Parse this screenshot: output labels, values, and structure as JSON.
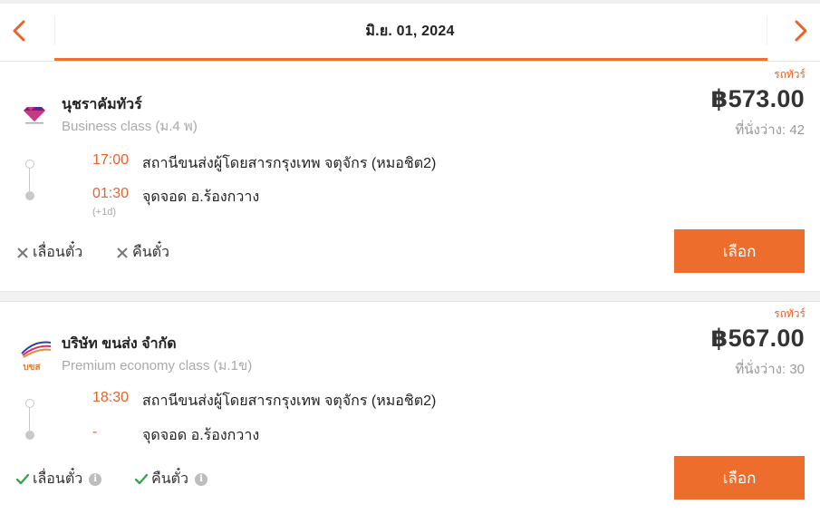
{
  "date_nav": {
    "date_label": "มิ.ย. 01, 2024",
    "prev_icon": "chevron-left-icon",
    "next_icon": "chevron-right-icon",
    "accent_color": "#f07030"
  },
  "trips": [
    {
      "tag": "รถทัวร์",
      "operator": "นุชราคัมทัวร์",
      "class": "Business class (ม.4 พ)",
      "price": "฿573.00",
      "seats": "ที่นั่งว่าง: 42",
      "depart_time": "17:00",
      "depart_station": "สถานีขนส่งผู้โดยสารกรุงเทพ จตุจักร (หมอชิต2)",
      "arrive_time": "01:30",
      "arrive_station": "จุดจอด อ.ร้องกวาง",
      "arrive_day_offset": "(+1d)",
      "reschedule_label": "เลื่อนตั๋ว",
      "reschedule_allowed": false,
      "refund_label": "คืนตั๋ว",
      "refund_allowed": false,
      "select_label": "เลือก"
    },
    {
      "tag": "รถทัวร์",
      "operator": "บริษัท ขนส่ง จำกัด",
      "class": "Premium economy class (ม.1ข)",
      "price": "฿567.00",
      "seats": "ที่นั่งว่าง: 30",
      "depart_time": "18:30",
      "depart_station": "สถานีขนส่งผู้โดยสารกรุงเทพ จตุจักร (หมอชิต2)",
      "arrive_time": "-",
      "arrive_station": "จุดจอด อ.ร้องกวาง",
      "reschedule_label": "เลื่อนตั๋ว",
      "reschedule_allowed": true,
      "refund_label": "คืนตั๋ว",
      "refund_allowed": true,
      "select_label": "เลือก",
      "logo_text": "บขส"
    }
  ]
}
